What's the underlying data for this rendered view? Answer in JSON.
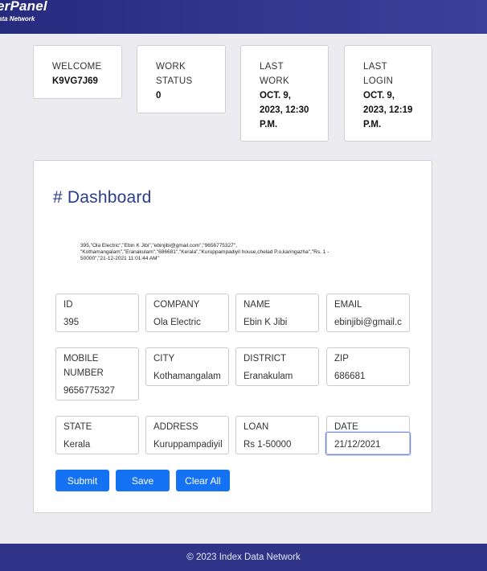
{
  "header": {
    "brand_title": "erPanel",
    "brand_subtitle": "ata Network"
  },
  "stats": {
    "welcome": {
      "label": "WELCOME",
      "value": "K9VG7J69"
    },
    "work_status": {
      "label": "WORK\nSTATUS",
      "value": "0"
    },
    "last_work": {
      "label": "LAST\nWORK",
      "value": "OCT. 9,\n2023, 12:30\nP.M."
    },
    "last_login": {
      "label": "LAST\nLOGIN",
      "value": "OCT. 9,\n2023, 12:19\nP.M."
    }
  },
  "dashboard": {
    "title": "# Dashboard",
    "raw_record": "395,\"Ola Electric\",\"Ebin K Jibi\",\"ebinjibi@gmail.com\",\"9656775327\", \"Kothamangalam\",\"Eranakulam\",\"686681\",\"Kerala\",\"Kuruppampadiyil house,chelad P.o,karingazha\",\"Rs. 1 - 50000\",\"21-12-2021 11:01:44 AM\""
  },
  "fields": {
    "id": {
      "label": "ID",
      "value": "395"
    },
    "company": {
      "label": "COMPANY",
      "value": "Ola Electric"
    },
    "name": {
      "label": "NAME",
      "value": "Ebin K Jibi"
    },
    "email": {
      "label": "EMAIL",
      "value": "ebinjibi@gmail.c"
    },
    "mobile": {
      "label": "MOBILE\nNUMBER",
      "value": "9656775327"
    },
    "city": {
      "label": "CITY",
      "value": "Kothamangalam"
    },
    "district": {
      "label": "DISTRICT",
      "value": "Eranakulam"
    },
    "zip": {
      "label": "ZIP",
      "value": "686681"
    },
    "state": {
      "label": "STATE",
      "value": "Kerala"
    },
    "address": {
      "label": "ADDRESS",
      "value": "Kuruppampadiyil"
    },
    "loan": {
      "label": "LOAN",
      "value": "Rs  1-50000"
    },
    "date": {
      "label": "DATE",
      "value": "21/12/2021"
    }
  },
  "actions": {
    "submit": "Submit",
    "save": "Save",
    "clear_all": "Clear All"
  },
  "footer": {
    "text": "© 2023 Index Data Network"
  },
  "colors": {
    "header_bg": "#2d3187",
    "accent_button": "#1572f2",
    "title_color": "#2a3c8c"
  }
}
